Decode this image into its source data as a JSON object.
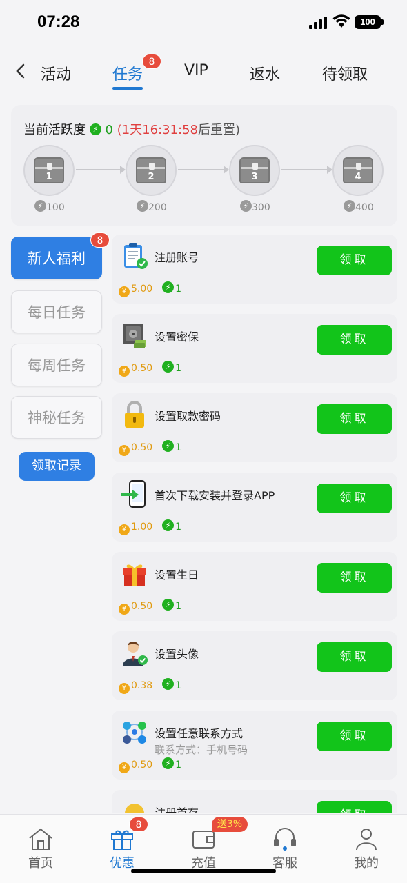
{
  "status_bar": {
    "time": "07:28",
    "battery": "100"
  },
  "top_nav": {
    "tabs": [
      "活动",
      "任务",
      "VIP",
      "返水",
      "待领取"
    ],
    "active_tab": "任务",
    "task_badge": "8"
  },
  "activity": {
    "title": "当前活跃度",
    "value": "0",
    "timer_prefix": "(",
    "timer": "1天16:31:58",
    "timer_suffix": "后重置)",
    "chests": [
      {
        "number": "1",
        "points": "100"
      },
      {
        "number": "2",
        "points": "200"
      },
      {
        "number": "3",
        "points": "300"
      },
      {
        "number": "4",
        "points": "400"
      }
    ]
  },
  "side_menu": {
    "items": [
      "新人福利",
      "每日任务",
      "每周任务",
      "神秘任务"
    ],
    "active": "新人福利",
    "badge": "8",
    "records_button": "领取记录"
  },
  "tasks": [
    {
      "title": "注册账号",
      "subtitle": "",
      "reward": "5.00",
      "activity": "1",
      "button": "领取",
      "icon": "clipboard-check-icon"
    },
    {
      "title": "设置密保",
      "subtitle": "",
      "reward": "0.50",
      "activity": "1",
      "button": "领取",
      "icon": "safe-icon"
    },
    {
      "title": "设置取款密码",
      "subtitle": "",
      "reward": "0.50",
      "activity": "1",
      "button": "领取",
      "icon": "padlock-icon"
    },
    {
      "title": "首次下载安装并登录APP",
      "subtitle": "",
      "reward": "1.00",
      "activity": "1",
      "button": "领取",
      "icon": "phone-download-icon"
    },
    {
      "title": "设置生日",
      "subtitle": "",
      "reward": "0.50",
      "activity": "1",
      "button": "领取",
      "icon": "gift-icon"
    },
    {
      "title": "设置头像",
      "subtitle": "",
      "reward": "0.38",
      "activity": "1",
      "button": "领取",
      "icon": "avatar-check-icon"
    },
    {
      "title": "设置任意联系方式",
      "subtitle": "联系方式：手机号码",
      "reward": "0.50",
      "activity": "1",
      "button": "领取",
      "icon": "contacts-icon"
    },
    {
      "title": "注册首存",
      "subtitle": "",
      "reward": "",
      "activity": "",
      "button": "领取",
      "icon": "coin-icon"
    }
  ],
  "bottom_nav": {
    "tabs": [
      "首页",
      "优惠",
      "充值",
      "客服",
      "我的"
    ],
    "active": "优惠",
    "promo_badge": "8",
    "recharge_badge": "送3%"
  },
  "colors": {
    "accent": "#1f78d1",
    "claim_green": "#12c41a",
    "badge_red": "#e74c3c"
  }
}
